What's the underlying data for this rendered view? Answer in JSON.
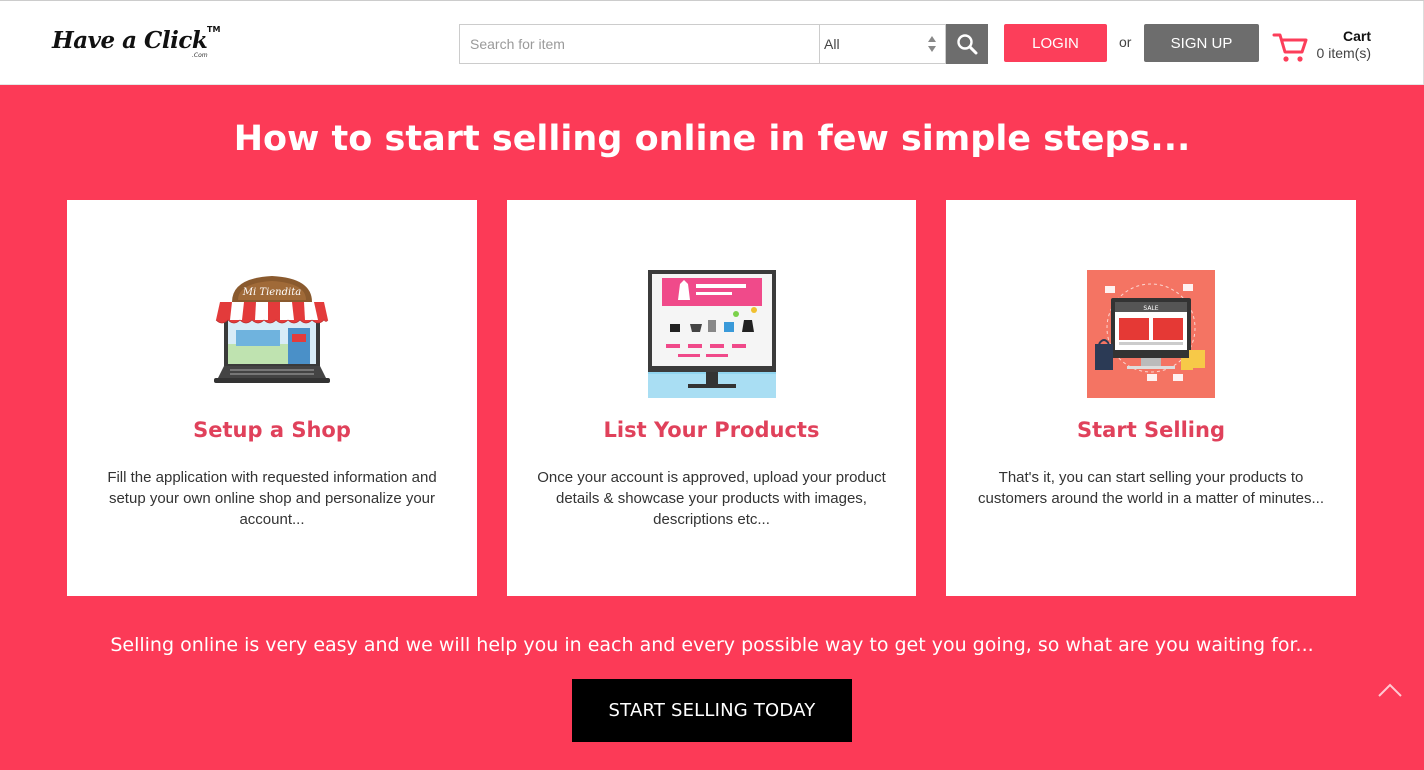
{
  "header": {
    "logo_text": "Have a Click",
    "logo_tm": "TM",
    "logo_com": ".Com",
    "search_placeholder": "Search for item",
    "category_selected": "All",
    "login_label": "LOGIN",
    "or_text": "or",
    "signup_label": "SIGN UP",
    "cart_label": "Cart",
    "cart_count": "0 item(s)"
  },
  "main": {
    "title": "How to start selling online in few simple steps...",
    "cards": [
      {
        "icon": "storefront-laptop-icon",
        "title": "Setup a Shop",
        "description": "Fill the application with requested information and setup your own online shop and personalize your account...",
        "storefront_sign": "Mi Tiendita"
      },
      {
        "icon": "product-listing-monitor-icon",
        "title": "List Your Products",
        "description": "Once your account is approved, upload your product details & showcase your products with images, descriptions etc..."
      },
      {
        "icon": "online-sale-monitor-icon",
        "title": "Start Selling",
        "description": "That's it, you can start selling your products to customers around the world in a matter of minutes...",
        "sale_text": "SALE"
      }
    ],
    "tagline": "Selling online is very easy and we will help you in each and every possible way to get you going, so what are you waiting for...",
    "cta_label": "START SELLING TODAY"
  },
  "colors": {
    "brand_red": "#fc3a57",
    "title_red": "#e0415b",
    "grey_button": "#6d6d6d"
  }
}
